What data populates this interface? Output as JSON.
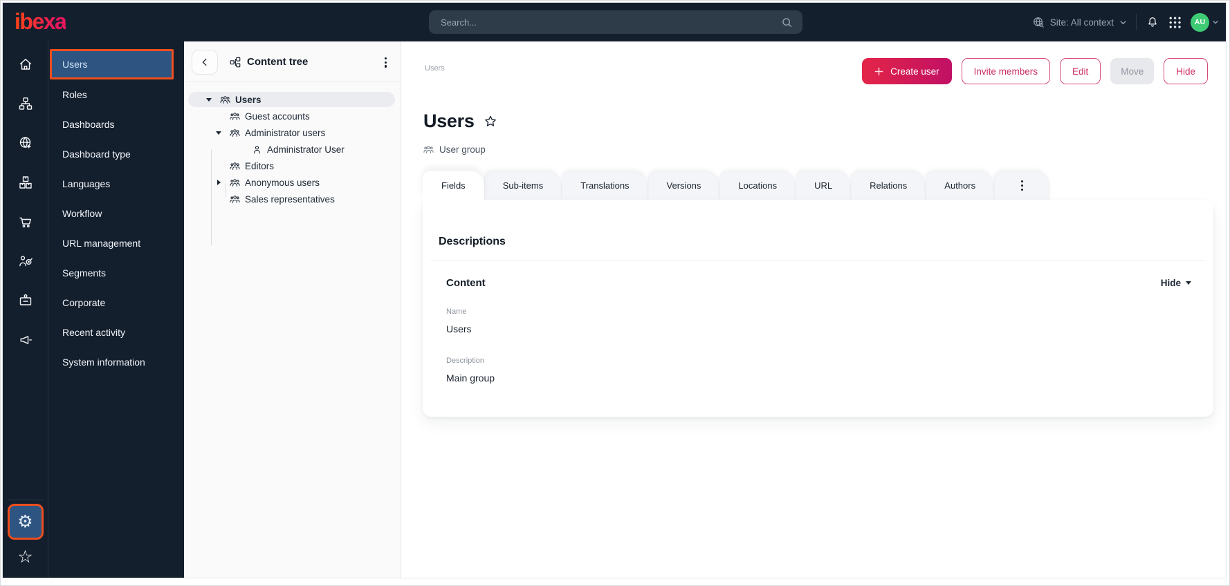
{
  "topbar": {
    "logo": "ibexa",
    "search_placeholder": "Search...",
    "site_context": "Site: All context",
    "avatar_initials": "AU"
  },
  "sidebar": {
    "rail_icons": [
      "home",
      "content-structure",
      "site",
      "product-catalog",
      "commerce",
      "personalization",
      "corporate",
      "announcements",
      "settings",
      "favorites"
    ],
    "items": [
      "Users",
      "Roles",
      "Dashboards",
      "Dashboard type",
      "Languages",
      "Workflow",
      "URL management",
      "Segments",
      "Corporate",
      "Recent activity",
      "System information"
    ],
    "active_item": "Users"
  },
  "content_tree": {
    "title": "Content tree",
    "items": [
      {
        "label": "Users",
        "depth": 0,
        "caret": "expanded",
        "icon": "user-group",
        "selected": true
      },
      {
        "label": "Guest accounts",
        "depth": 1,
        "caret": "none",
        "icon": "user-group",
        "selected": false
      },
      {
        "label": "Administrator users",
        "depth": 1,
        "caret": "expanded",
        "icon": "user-group",
        "selected": false
      },
      {
        "label": "Administrator User",
        "depth": 2,
        "caret": "none",
        "icon": "user",
        "selected": false
      },
      {
        "label": "Editors",
        "depth": 1,
        "caret": "none",
        "icon": "user-group",
        "selected": false
      },
      {
        "label": "Anonymous users",
        "depth": 1,
        "caret": "collapsed",
        "icon": "user-group",
        "selected": false
      },
      {
        "label": "Sales representatives",
        "depth": 1,
        "caret": "none",
        "icon": "user-group",
        "selected": false
      }
    ]
  },
  "main": {
    "breadcrumb": "Users",
    "page_title": "Users",
    "content_type_label": "User group",
    "actions": {
      "create": "Create user",
      "invite": "Invite members",
      "edit": "Edit",
      "move": "Move",
      "hide": "Hide"
    },
    "tabs": [
      "Fields",
      "Sub-items",
      "Translations",
      "Versions",
      "Locations",
      "URL",
      "Relations",
      "Authors"
    ],
    "active_tab": "Fields",
    "card": {
      "heading": "Descriptions",
      "section_title": "Content",
      "collapse_label": "Hide",
      "fields": [
        {
          "label": "Name",
          "value": "Users"
        },
        {
          "label": "Description",
          "value": "Main group"
        }
      ]
    }
  },
  "colors": {
    "topbar_bg": "#141f2e",
    "annotation_highlight": "#ee4e1d",
    "active_item_bg": "#2e5582",
    "brand_gradient_start": "#ff4318",
    "brand_gradient_end": "#e8175d",
    "primary_button_gradient_start": "#e32547",
    "primary_button_gradient_end": "#c11065",
    "outline_button_text": "#cb2e67",
    "avatar_bg": "#3ecb74",
    "tree_selected_bg": "#ebecf0"
  }
}
